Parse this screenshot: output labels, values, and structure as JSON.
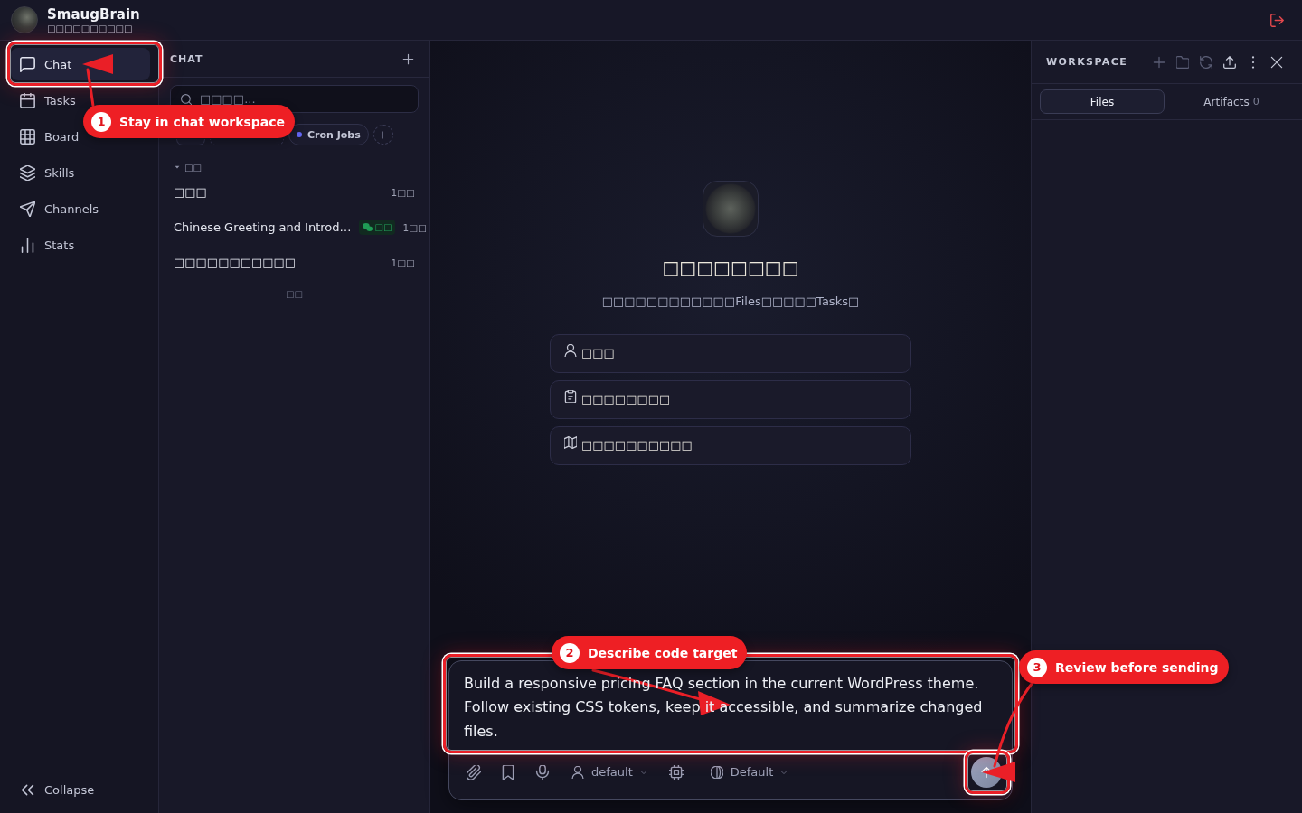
{
  "app": {
    "name": "SmaugBrain",
    "subtitle": "□□□□□□□□□□"
  },
  "nav": {
    "items": [
      {
        "label": "Chat",
        "selected": true
      },
      {
        "label": "Tasks",
        "selected": false
      },
      {
        "label": "Board",
        "selected": false
      },
      {
        "label": "Skills",
        "selected": false
      },
      {
        "label": "Channels",
        "selected": false
      },
      {
        "label": "Stats",
        "selected": false
      }
    ],
    "collapse": "Collapse"
  },
  "chat_panel": {
    "title": "CHAT",
    "search": {
      "placeholder": "□□□□..."
    },
    "filters": [
      {
        "kind": "solid"
      },
      {
        "kind": "dashed"
      },
      {
        "kind": "tag",
        "label": "Cron Jobs",
        "color": "#6366f1"
      },
      {
        "kind": "add"
      }
    ],
    "groups": [
      {
        "label": "□□",
        "expanded": true,
        "conversations": [
          {
            "title": "□□□",
            "time": "1□□"
          },
          {
            "title": "Chinese Greeting and Introd…",
            "badge": "□□",
            "time": "1□□"
          },
          {
            "title": "□□□□□□□□□□□",
            "time": "1□□"
          }
        ]
      }
    ],
    "footer": "□□"
  },
  "welcome": {
    "title": "□□□□□□□□",
    "subtitle": "□□□□□□□□□□□□Files□□□□□Tasks□",
    "suggestions": [
      "□□□",
      "□□□□□□□□",
      "□□□□□□□□□□"
    ]
  },
  "composer": {
    "value": "Build a responsive pricing FAQ section in the current WordPress theme. Follow existing CSS tokens, keep it accessible, and summarize changed files.",
    "agent": "default",
    "mode": "Default"
  },
  "workspace": {
    "title": "WORKSPACE",
    "tabs": [
      {
        "label": "Files",
        "selected": true
      },
      {
        "label": "Artifacts",
        "count": "0",
        "selected": false
      }
    ]
  },
  "annotations": [
    {
      "number": "1",
      "label": "Stay in chat workspace"
    },
    {
      "number": "2",
      "label": "Describe code target"
    },
    {
      "number": "3",
      "label": "Review before sending"
    }
  ]
}
